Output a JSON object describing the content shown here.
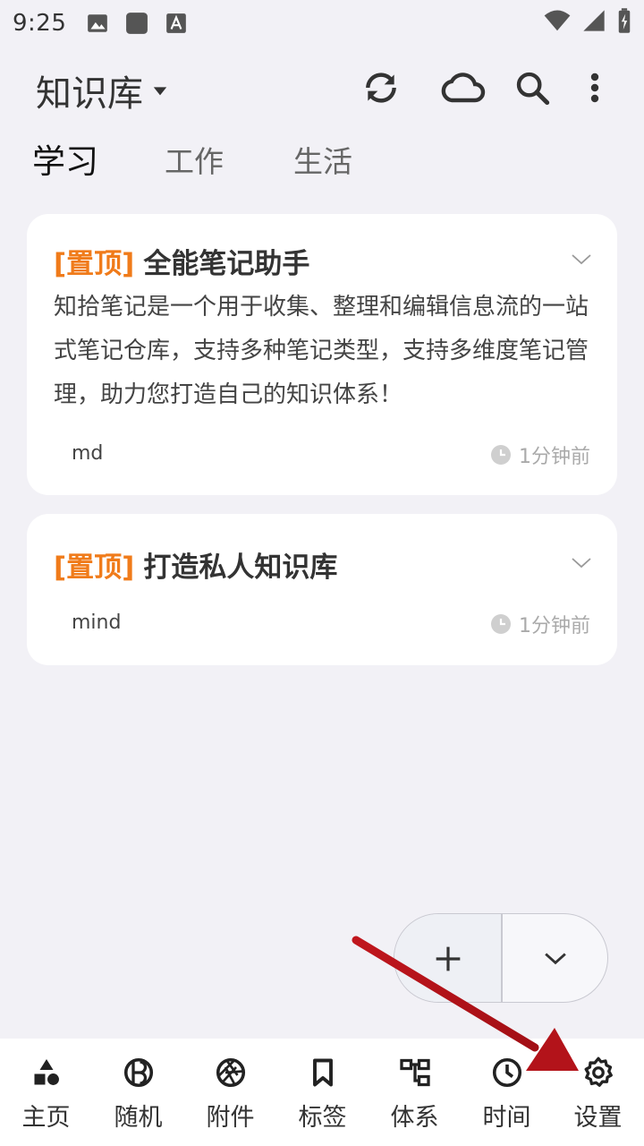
{
  "status_bar": {
    "time": "9:25",
    "left_icons": [
      "image-icon",
      "app-square-icon",
      "font-a-icon"
    ],
    "right_icons": [
      "wifi-icon",
      "signal-icon",
      "battery-charging-icon"
    ]
  },
  "header": {
    "title": "知识库",
    "actions": [
      "sync-icon",
      "cloud-icon",
      "search-icon",
      "more-vert-icon"
    ]
  },
  "tabs": [
    {
      "label": "学习",
      "active": true
    },
    {
      "label": "工作",
      "active": false
    },
    {
      "label": "生活",
      "active": false
    }
  ],
  "notes": [
    {
      "pin": "[置顶]",
      "title": "全能笔记助手",
      "body": "知拾笔记是一个用于收集、整理和编辑信息流的一站式笔记仓库，支持多种笔记类型，支持多维度笔记管理，助力您打造自己的知识体系！",
      "tag": "md",
      "time": "1分钟前"
    },
    {
      "pin": "[置顶]",
      "title": "打造私人知识库",
      "body": "",
      "tag": "mind",
      "time": "1分钟前"
    }
  ],
  "fab": {
    "add": "plus-icon",
    "more": "chevron-down-icon"
  },
  "bottom_nav": [
    {
      "label": "主页",
      "icon": "shapes-icon"
    },
    {
      "label": "随机",
      "icon": "random-icon"
    },
    {
      "label": "附件",
      "icon": "aperture-icon"
    },
    {
      "label": "标签",
      "icon": "bookmark-icon"
    },
    {
      "label": "体系",
      "icon": "hierarchy-icon"
    },
    {
      "label": "时间",
      "icon": "clock-icon"
    },
    {
      "label": "设置",
      "icon": "gear-icon"
    }
  ],
  "colors": {
    "background": "#f2f1f6",
    "card": "#ffffff",
    "pin_accent": "#f07b1a",
    "annotation_arrow": "#c0161d"
  }
}
